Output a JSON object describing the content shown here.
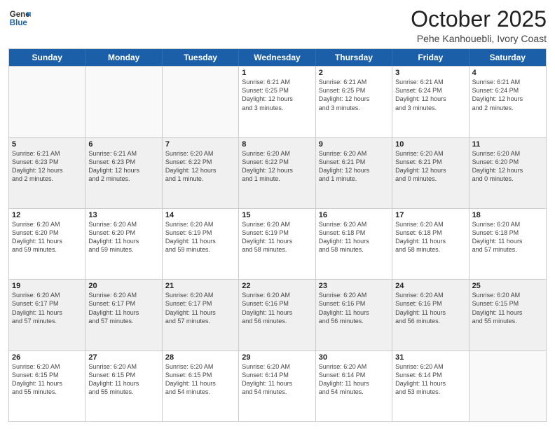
{
  "header": {
    "logo_line1": "General",
    "logo_line2": "Blue",
    "month": "October 2025",
    "location": "Pehe Kanhouebli, Ivory Coast"
  },
  "weekdays": [
    "Sunday",
    "Monday",
    "Tuesday",
    "Wednesday",
    "Thursday",
    "Friday",
    "Saturday"
  ],
  "rows": [
    [
      {
        "num": "",
        "info": ""
      },
      {
        "num": "",
        "info": ""
      },
      {
        "num": "",
        "info": ""
      },
      {
        "num": "1",
        "info": "Sunrise: 6:21 AM\nSunset: 6:25 PM\nDaylight: 12 hours\nand 3 minutes."
      },
      {
        "num": "2",
        "info": "Sunrise: 6:21 AM\nSunset: 6:25 PM\nDaylight: 12 hours\nand 3 minutes."
      },
      {
        "num": "3",
        "info": "Sunrise: 6:21 AM\nSunset: 6:24 PM\nDaylight: 12 hours\nand 3 minutes."
      },
      {
        "num": "4",
        "info": "Sunrise: 6:21 AM\nSunset: 6:24 PM\nDaylight: 12 hours\nand 2 minutes."
      }
    ],
    [
      {
        "num": "5",
        "info": "Sunrise: 6:21 AM\nSunset: 6:23 PM\nDaylight: 12 hours\nand 2 minutes."
      },
      {
        "num": "6",
        "info": "Sunrise: 6:21 AM\nSunset: 6:23 PM\nDaylight: 12 hours\nand 2 minutes."
      },
      {
        "num": "7",
        "info": "Sunrise: 6:20 AM\nSunset: 6:22 PM\nDaylight: 12 hours\nand 1 minute."
      },
      {
        "num": "8",
        "info": "Sunrise: 6:20 AM\nSunset: 6:22 PM\nDaylight: 12 hours\nand 1 minute."
      },
      {
        "num": "9",
        "info": "Sunrise: 6:20 AM\nSunset: 6:21 PM\nDaylight: 12 hours\nand 1 minute."
      },
      {
        "num": "10",
        "info": "Sunrise: 6:20 AM\nSunset: 6:21 PM\nDaylight: 12 hours\nand 0 minutes."
      },
      {
        "num": "11",
        "info": "Sunrise: 6:20 AM\nSunset: 6:20 PM\nDaylight: 12 hours\nand 0 minutes."
      }
    ],
    [
      {
        "num": "12",
        "info": "Sunrise: 6:20 AM\nSunset: 6:20 PM\nDaylight: 11 hours\nand 59 minutes."
      },
      {
        "num": "13",
        "info": "Sunrise: 6:20 AM\nSunset: 6:20 PM\nDaylight: 11 hours\nand 59 minutes."
      },
      {
        "num": "14",
        "info": "Sunrise: 6:20 AM\nSunset: 6:19 PM\nDaylight: 11 hours\nand 59 minutes."
      },
      {
        "num": "15",
        "info": "Sunrise: 6:20 AM\nSunset: 6:19 PM\nDaylight: 11 hours\nand 58 minutes."
      },
      {
        "num": "16",
        "info": "Sunrise: 6:20 AM\nSunset: 6:18 PM\nDaylight: 11 hours\nand 58 minutes."
      },
      {
        "num": "17",
        "info": "Sunrise: 6:20 AM\nSunset: 6:18 PM\nDaylight: 11 hours\nand 58 minutes."
      },
      {
        "num": "18",
        "info": "Sunrise: 6:20 AM\nSunset: 6:18 PM\nDaylight: 11 hours\nand 57 minutes."
      }
    ],
    [
      {
        "num": "19",
        "info": "Sunrise: 6:20 AM\nSunset: 6:17 PM\nDaylight: 11 hours\nand 57 minutes."
      },
      {
        "num": "20",
        "info": "Sunrise: 6:20 AM\nSunset: 6:17 PM\nDaylight: 11 hours\nand 57 minutes."
      },
      {
        "num": "21",
        "info": "Sunrise: 6:20 AM\nSunset: 6:17 PM\nDaylight: 11 hours\nand 57 minutes."
      },
      {
        "num": "22",
        "info": "Sunrise: 6:20 AM\nSunset: 6:16 PM\nDaylight: 11 hours\nand 56 minutes."
      },
      {
        "num": "23",
        "info": "Sunrise: 6:20 AM\nSunset: 6:16 PM\nDaylight: 11 hours\nand 56 minutes."
      },
      {
        "num": "24",
        "info": "Sunrise: 6:20 AM\nSunset: 6:16 PM\nDaylight: 11 hours\nand 56 minutes."
      },
      {
        "num": "25",
        "info": "Sunrise: 6:20 AM\nSunset: 6:15 PM\nDaylight: 11 hours\nand 55 minutes."
      }
    ],
    [
      {
        "num": "26",
        "info": "Sunrise: 6:20 AM\nSunset: 6:15 PM\nDaylight: 11 hours\nand 55 minutes."
      },
      {
        "num": "27",
        "info": "Sunrise: 6:20 AM\nSunset: 6:15 PM\nDaylight: 11 hours\nand 55 minutes."
      },
      {
        "num": "28",
        "info": "Sunrise: 6:20 AM\nSunset: 6:15 PM\nDaylight: 11 hours\nand 54 minutes."
      },
      {
        "num": "29",
        "info": "Sunrise: 6:20 AM\nSunset: 6:14 PM\nDaylight: 11 hours\nand 54 minutes."
      },
      {
        "num": "30",
        "info": "Sunrise: 6:20 AM\nSunset: 6:14 PM\nDaylight: 11 hours\nand 54 minutes."
      },
      {
        "num": "31",
        "info": "Sunrise: 6:20 AM\nSunset: 6:14 PM\nDaylight: 11 hours\nand 53 minutes."
      },
      {
        "num": "",
        "info": ""
      }
    ]
  ],
  "shaded_rows": [
    1,
    3
  ],
  "colors": {
    "header_bg": "#1a5fa8",
    "header_text": "#ffffff",
    "cell_shaded": "#f0f0f0",
    "cell_normal": "#ffffff"
  }
}
